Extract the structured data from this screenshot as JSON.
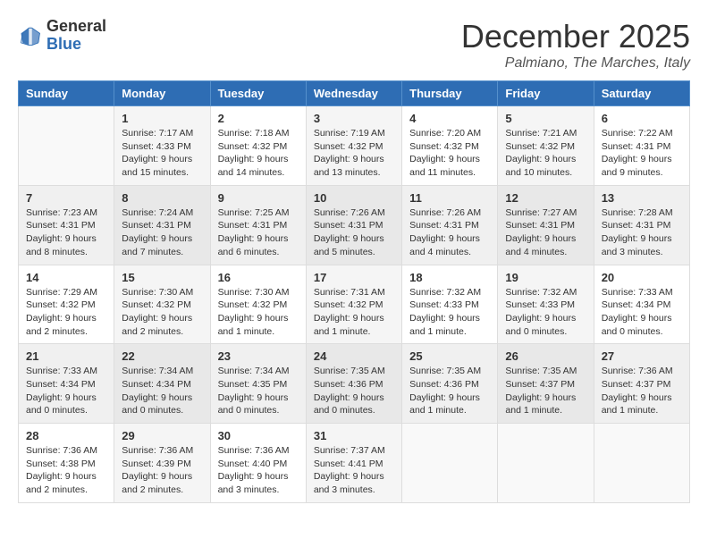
{
  "header": {
    "logo_general": "General",
    "logo_blue": "Blue",
    "month_title": "December 2025",
    "location": "Palmiano, The Marches, Italy"
  },
  "days_of_week": [
    "Sunday",
    "Monday",
    "Tuesday",
    "Wednesday",
    "Thursday",
    "Friday",
    "Saturday"
  ],
  "weeks": [
    [
      {
        "day": "",
        "info": ""
      },
      {
        "day": "1",
        "info": "Sunrise: 7:17 AM\nSunset: 4:33 PM\nDaylight: 9 hours\nand 15 minutes."
      },
      {
        "day": "2",
        "info": "Sunrise: 7:18 AM\nSunset: 4:32 PM\nDaylight: 9 hours\nand 14 minutes."
      },
      {
        "day": "3",
        "info": "Sunrise: 7:19 AM\nSunset: 4:32 PM\nDaylight: 9 hours\nand 13 minutes."
      },
      {
        "day": "4",
        "info": "Sunrise: 7:20 AM\nSunset: 4:32 PM\nDaylight: 9 hours\nand 11 minutes."
      },
      {
        "day": "5",
        "info": "Sunrise: 7:21 AM\nSunset: 4:32 PM\nDaylight: 9 hours\nand 10 minutes."
      },
      {
        "day": "6",
        "info": "Sunrise: 7:22 AM\nSunset: 4:31 PM\nDaylight: 9 hours\nand 9 minutes."
      }
    ],
    [
      {
        "day": "7",
        "info": "Sunrise: 7:23 AM\nSunset: 4:31 PM\nDaylight: 9 hours\nand 8 minutes."
      },
      {
        "day": "8",
        "info": "Sunrise: 7:24 AM\nSunset: 4:31 PM\nDaylight: 9 hours\nand 7 minutes."
      },
      {
        "day": "9",
        "info": "Sunrise: 7:25 AM\nSunset: 4:31 PM\nDaylight: 9 hours\nand 6 minutes."
      },
      {
        "day": "10",
        "info": "Sunrise: 7:26 AM\nSunset: 4:31 PM\nDaylight: 9 hours\nand 5 minutes."
      },
      {
        "day": "11",
        "info": "Sunrise: 7:26 AM\nSunset: 4:31 PM\nDaylight: 9 hours\nand 4 minutes."
      },
      {
        "day": "12",
        "info": "Sunrise: 7:27 AM\nSunset: 4:31 PM\nDaylight: 9 hours\nand 4 minutes."
      },
      {
        "day": "13",
        "info": "Sunrise: 7:28 AM\nSunset: 4:31 PM\nDaylight: 9 hours\nand 3 minutes."
      }
    ],
    [
      {
        "day": "14",
        "info": "Sunrise: 7:29 AM\nSunset: 4:32 PM\nDaylight: 9 hours\nand 2 minutes."
      },
      {
        "day": "15",
        "info": "Sunrise: 7:30 AM\nSunset: 4:32 PM\nDaylight: 9 hours\nand 2 minutes."
      },
      {
        "day": "16",
        "info": "Sunrise: 7:30 AM\nSunset: 4:32 PM\nDaylight: 9 hours\nand 1 minute."
      },
      {
        "day": "17",
        "info": "Sunrise: 7:31 AM\nSunset: 4:32 PM\nDaylight: 9 hours\nand 1 minute."
      },
      {
        "day": "18",
        "info": "Sunrise: 7:32 AM\nSunset: 4:33 PM\nDaylight: 9 hours\nand 1 minute."
      },
      {
        "day": "19",
        "info": "Sunrise: 7:32 AM\nSunset: 4:33 PM\nDaylight: 9 hours\nand 0 minutes."
      },
      {
        "day": "20",
        "info": "Sunrise: 7:33 AM\nSunset: 4:34 PM\nDaylight: 9 hours\nand 0 minutes."
      }
    ],
    [
      {
        "day": "21",
        "info": "Sunrise: 7:33 AM\nSunset: 4:34 PM\nDaylight: 9 hours\nand 0 minutes."
      },
      {
        "day": "22",
        "info": "Sunrise: 7:34 AM\nSunset: 4:34 PM\nDaylight: 9 hours\nand 0 minutes."
      },
      {
        "day": "23",
        "info": "Sunrise: 7:34 AM\nSunset: 4:35 PM\nDaylight: 9 hours\nand 0 minutes."
      },
      {
        "day": "24",
        "info": "Sunrise: 7:35 AM\nSunset: 4:36 PM\nDaylight: 9 hours\nand 0 minutes."
      },
      {
        "day": "25",
        "info": "Sunrise: 7:35 AM\nSunset: 4:36 PM\nDaylight: 9 hours\nand 1 minute."
      },
      {
        "day": "26",
        "info": "Sunrise: 7:35 AM\nSunset: 4:37 PM\nDaylight: 9 hours\nand 1 minute."
      },
      {
        "day": "27",
        "info": "Sunrise: 7:36 AM\nSunset: 4:37 PM\nDaylight: 9 hours\nand 1 minute."
      }
    ],
    [
      {
        "day": "28",
        "info": "Sunrise: 7:36 AM\nSunset: 4:38 PM\nDaylight: 9 hours\nand 2 minutes."
      },
      {
        "day": "29",
        "info": "Sunrise: 7:36 AM\nSunset: 4:39 PM\nDaylight: 9 hours\nand 2 minutes."
      },
      {
        "day": "30",
        "info": "Sunrise: 7:36 AM\nSunset: 4:40 PM\nDaylight: 9 hours\nand 3 minutes."
      },
      {
        "day": "31",
        "info": "Sunrise: 7:37 AM\nSunset: 4:41 PM\nDaylight: 9 hours\nand 3 minutes."
      },
      {
        "day": "",
        "info": ""
      },
      {
        "day": "",
        "info": ""
      },
      {
        "day": "",
        "info": ""
      }
    ]
  ]
}
